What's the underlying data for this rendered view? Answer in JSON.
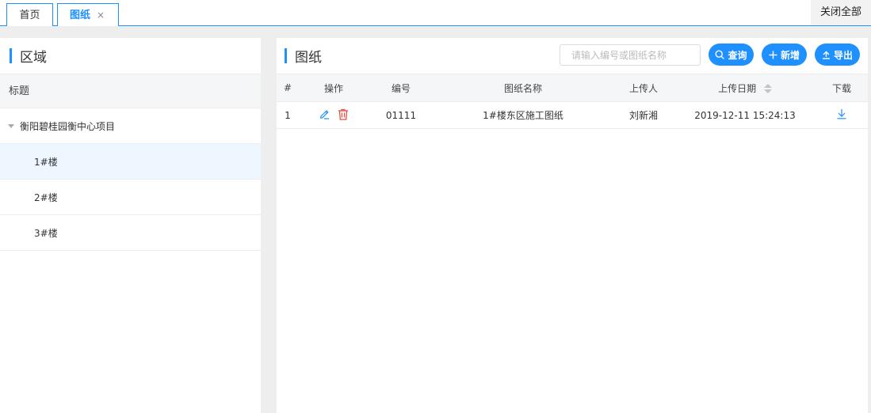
{
  "tabs": {
    "home_label": "首页",
    "drawing_label": "图纸",
    "close_glyph": "×",
    "close_all_label": "关闭全部"
  },
  "left_panel": {
    "title": "区域",
    "tree_header": "标题",
    "root_item": "衡阳碧桂园衡中心项目",
    "children": [
      "1#楼",
      "2#楼",
      "3#楼"
    ]
  },
  "right_panel": {
    "title": "图纸",
    "search_placeholder": "请输入编号或图纸名称",
    "query_label": "查询",
    "add_label": "新增",
    "export_label": "导出"
  },
  "table": {
    "columns": [
      "#",
      "操作",
      "编号",
      "图纸名称",
      "上传人",
      "上传日期",
      "下载"
    ],
    "rows": [
      {
        "index": "1",
        "code": "01111",
        "name": "1#楼东区施工图纸",
        "uploader": "刘新湘",
        "upload_date": "2019-12-11 15:24:13"
      }
    ]
  },
  "colors": {
    "accent": "#1e90ff",
    "delete": "#e84c3d"
  },
  "icons": [
    "close-icon",
    "search-icon",
    "plus-icon",
    "upload-icon",
    "edit-icon",
    "trash-icon",
    "download-icon",
    "sort-icon"
  ]
}
